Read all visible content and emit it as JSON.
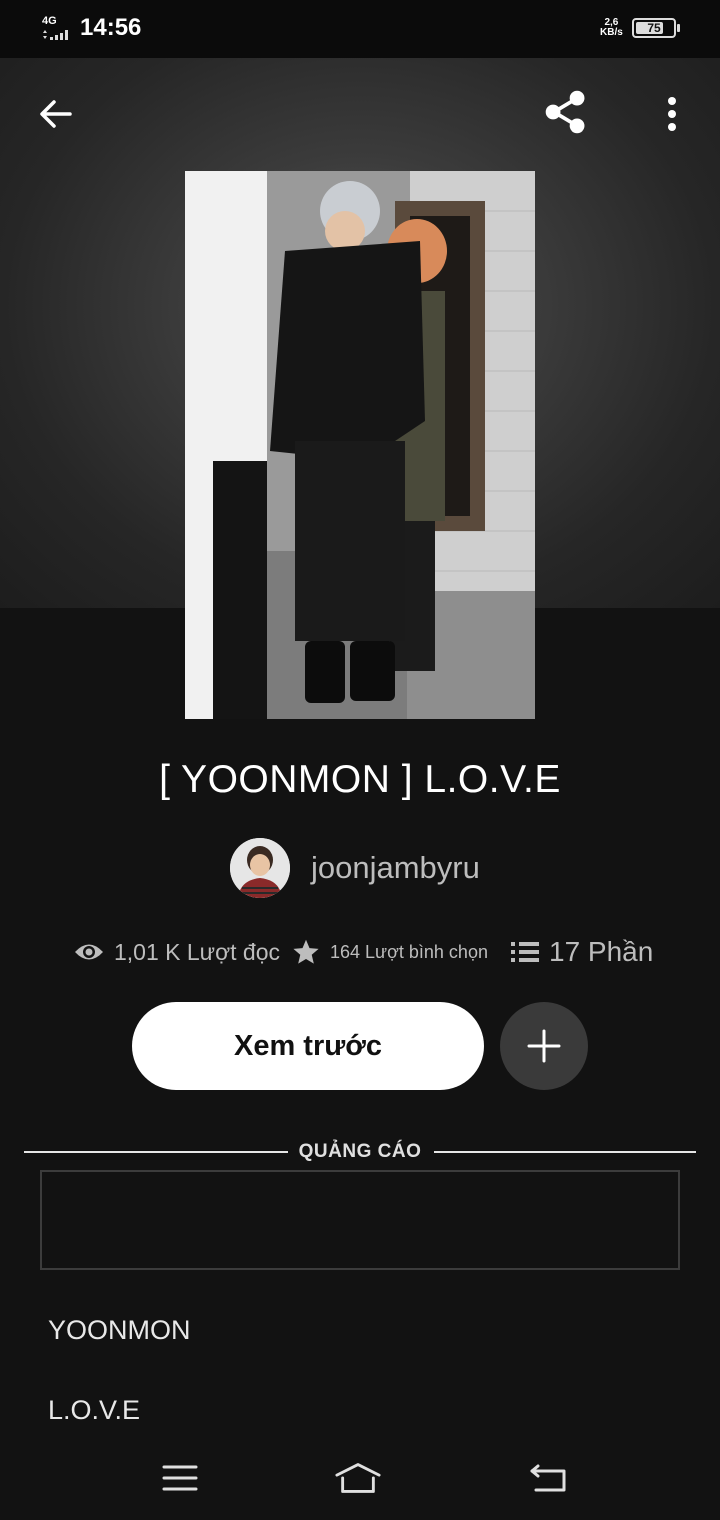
{
  "status_bar": {
    "network": "4G",
    "time": "14:56",
    "speed_value": "2,6",
    "speed_unit": "KB/s",
    "battery": "75",
    "battery_level": 0.75
  },
  "toolbar": {
    "back_icon": "arrow-left-icon",
    "share_icon": "share-icon",
    "more_icon": "more-vertical-icon"
  },
  "story": {
    "title": "[ YOONMON ] L.O.V.E",
    "author": "joonjambyru",
    "stats": {
      "reads": "1,01 K Lượt đọc",
      "votes": "164 Lượt bình chọn",
      "parts": "17 Phần"
    },
    "preview_button": "Xem trước",
    "add_icon": "plus-icon"
  },
  "ad": {
    "label": "QUẢNG CÁO"
  },
  "tags": [
    "YOONMON",
    "L.O.V.E"
  ],
  "nav": {
    "menu_icon": "menu-icon",
    "home_icon": "home-icon",
    "back_icon": "back-icon"
  }
}
